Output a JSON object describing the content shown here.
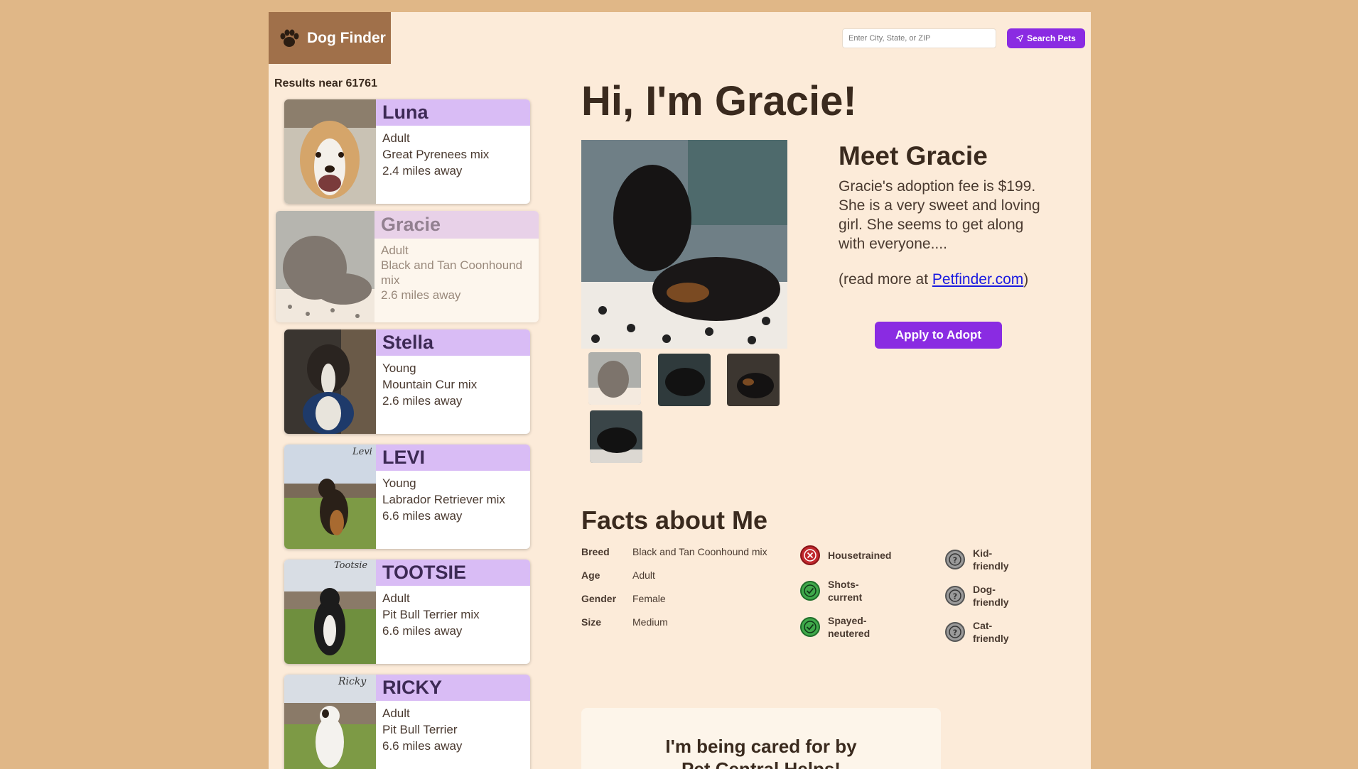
{
  "app": {
    "title": "Dog Finder"
  },
  "search": {
    "placeholder": "Enter City, State, or ZIP",
    "button_label": "Search Pets"
  },
  "results": {
    "label": "Results near 61761",
    "pets": [
      {
        "name": "Luna",
        "age": "Adult",
        "breed": "Great Pyrenees mix",
        "distance": "2.4 miles away"
      },
      {
        "name": "Gracie",
        "age": "Adult",
        "breed": "Black and Tan Coonhound mix",
        "distance": "2.6 miles away"
      },
      {
        "name": "Stella",
        "age": "Young",
        "breed": "Mountain Cur mix",
        "distance": "2.6 miles away"
      },
      {
        "name": "LEVI",
        "age": "Young",
        "breed": "Labrador Retriever mix",
        "distance": "6.6 miles away"
      },
      {
        "name": "TOOTSIE",
        "age": "Adult",
        "breed": "Pit Bull Terrier mix",
        "distance": "6.6 miles away"
      },
      {
        "name": "RICKY",
        "age": "Adult",
        "breed": "Pit Bull Terrier",
        "distance": "6.6 miles away"
      }
    ]
  },
  "detail": {
    "hero_title": "Hi, I'm Gracie!",
    "meet_title": "Meet Gracie",
    "description": "Gracie's adoption fee is $199. She is a very sweet and loving girl. She seems to get along with everyone....",
    "read_more_prefix": "(read more at ",
    "read_more_link": "Petfinder.com",
    "read_more_suffix": ")",
    "adopt_label": "Apply to Adopt"
  },
  "facts": {
    "title": "Facts about Me",
    "rows": [
      {
        "label": "Breed",
        "value": "Black and Tan Coonhound mix"
      },
      {
        "label": "Age",
        "value": "Adult"
      },
      {
        "label": "Gender",
        "value": "Female"
      },
      {
        "label": "Size",
        "value": "Medium"
      }
    ],
    "traits": [
      {
        "label": "Housetrained",
        "status": "no"
      },
      {
        "label": "Shots-current",
        "status": "yes"
      },
      {
        "label": "Spayed-neutered",
        "status": "yes"
      },
      {
        "label": "Kid-friendly",
        "status": "unknown"
      },
      {
        "label": "Dog-friendly",
        "status": "unknown"
      },
      {
        "label": "Cat-friendly",
        "status": "unknown"
      }
    ]
  },
  "caretaker": {
    "line1": "I'm being cared for by",
    "line2": "Pet Central Helps!"
  },
  "colors": {
    "accent": "#8a2be2",
    "header": "#a0704a",
    "background": "#e0b787",
    "panel": "#fcebd9",
    "name_band": "#d9bcf5"
  }
}
